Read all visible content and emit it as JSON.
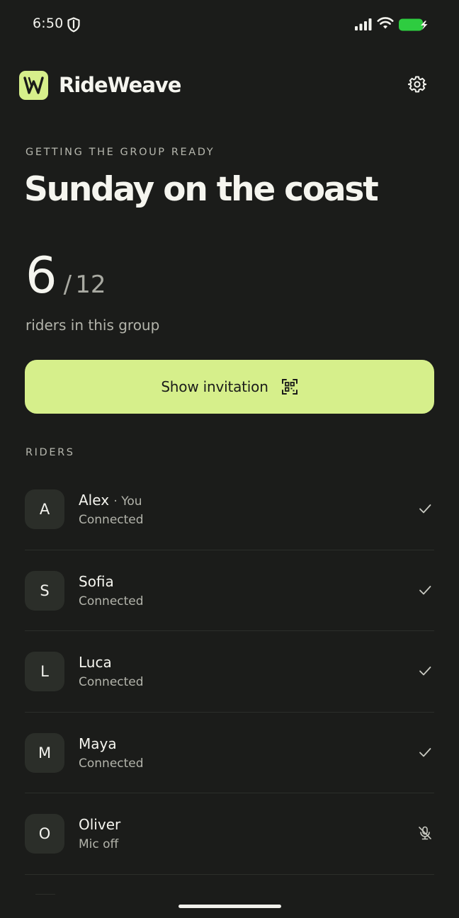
{
  "status_bar": {
    "time": "6:50",
    "battery_color": "#2ecc40"
  },
  "app": {
    "name": "RideWeave",
    "accent": "#d6ef8b",
    "settings_icon": "gear-icon"
  },
  "group": {
    "eyebrow": "GETTING THE GROUP READY",
    "title": "Sunday on the coast",
    "current_count": "6",
    "separator": "/",
    "max_count": "12",
    "caption": "riders in this group"
  },
  "invite": {
    "label": "Show invitation",
    "icon": "qr-scan-icon"
  },
  "riders_section": {
    "label": "RIDERS",
    "items": [
      {
        "initial": "A",
        "name": "Alex",
        "suffix": "· You",
        "status": "Connected",
        "indicator": "check-icon"
      },
      {
        "initial": "S",
        "name": "Sofia",
        "suffix": "",
        "status": "Connected",
        "indicator": "check-icon"
      },
      {
        "initial": "L",
        "name": "Luca",
        "suffix": "",
        "status": "Connected",
        "indicator": "check-icon"
      },
      {
        "initial": "M",
        "name": "Maya",
        "suffix": "",
        "status": "Connected",
        "indicator": "check-icon"
      },
      {
        "initial": "O",
        "name": "Oliver",
        "suffix": "",
        "status": "Mic off",
        "indicator": "mic-off-icon"
      }
    ]
  }
}
